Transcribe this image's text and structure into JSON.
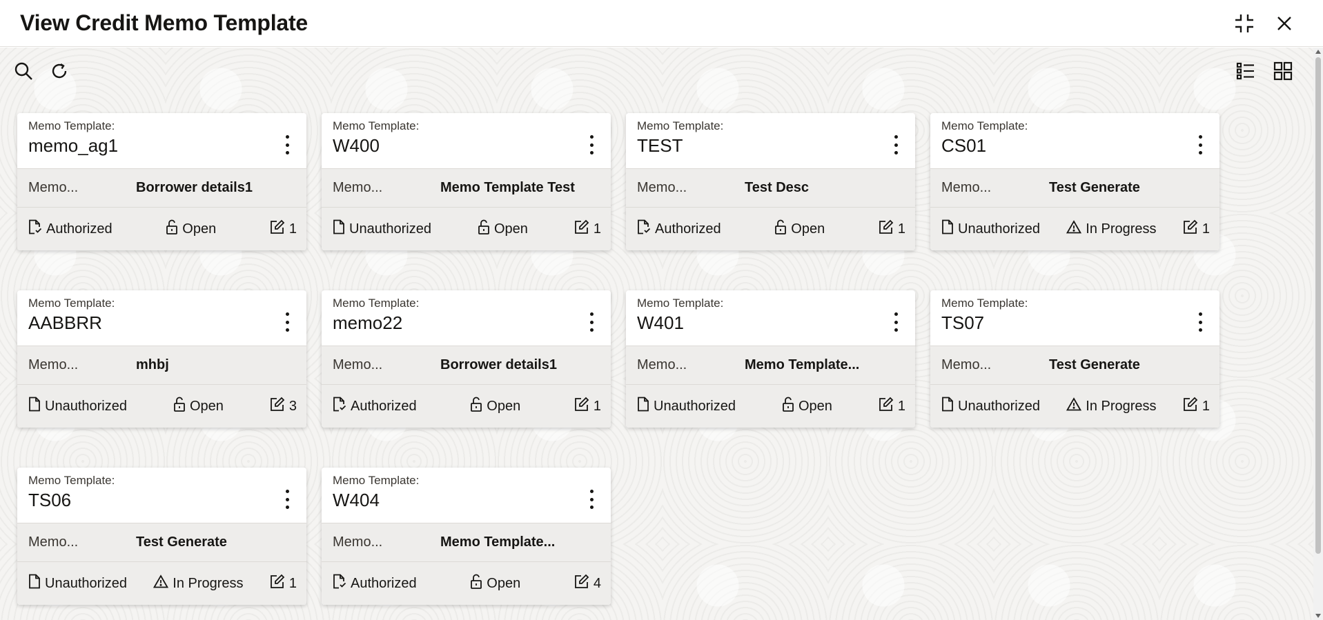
{
  "window": {
    "title": "View Credit Memo Template"
  },
  "cards": [
    {
      "label": "Memo Template:",
      "name": "memo_ag1",
      "desc_label": "Memo...",
      "desc_value": "Borrower details1",
      "status": "Authorized",
      "status_icon": "doc-check-icon",
      "lock": "Open",
      "lock_icon": "unlock-icon",
      "edits": "1"
    },
    {
      "label": "Memo Template:",
      "name": "W400",
      "desc_label": "Memo...",
      "desc_value": "Memo Template Test",
      "status": "Unauthorized",
      "status_icon": "doc-icon",
      "lock": "Open",
      "lock_icon": "unlock-icon",
      "edits": "1"
    },
    {
      "label": "Memo Template:",
      "name": "TEST",
      "desc_label": "Memo...",
      "desc_value": "Test Desc",
      "status": "Authorized",
      "status_icon": "doc-check-icon",
      "lock": "Open",
      "lock_icon": "unlock-icon",
      "edits": "1"
    },
    {
      "label": "Memo Template:",
      "name": "CS01",
      "desc_label": "Memo...",
      "desc_value": "Test Generate",
      "status": "Unauthorized",
      "status_icon": "doc-icon",
      "lock": "In Progress",
      "lock_icon": "warning-icon",
      "edits": "1"
    },
    {
      "label": "Memo Template:",
      "name": "AABBRR",
      "desc_label": "Memo...",
      "desc_value": "mhbj",
      "status": "Unauthorized",
      "status_icon": "doc-icon",
      "lock": "Open",
      "lock_icon": "unlock-icon",
      "edits": "3"
    },
    {
      "label": "Memo Template:",
      "name": "memo22",
      "desc_label": "Memo...",
      "desc_value": "Borrower details1",
      "status": "Authorized",
      "status_icon": "doc-check-icon",
      "lock": "Open",
      "lock_icon": "unlock-icon",
      "edits": "1"
    },
    {
      "label": "Memo Template:",
      "name": "W401",
      "desc_label": "Memo...",
      "desc_value": "Memo Template...",
      "status": "Unauthorized",
      "status_icon": "doc-icon",
      "lock": "Open",
      "lock_icon": "unlock-icon",
      "edits": "1"
    },
    {
      "label": "Memo Template:",
      "name": "TS07",
      "desc_label": "Memo...",
      "desc_value": "Test Generate",
      "status": "Unauthorized",
      "status_icon": "doc-icon",
      "lock": "In Progress",
      "lock_icon": "warning-icon",
      "edits": "1"
    },
    {
      "label": "Memo Template:",
      "name": "TS06",
      "desc_label": "Memo...",
      "desc_value": "Test Generate",
      "status": "Unauthorized",
      "status_icon": "doc-icon",
      "lock": "In Progress",
      "lock_icon": "warning-icon",
      "edits": "1"
    },
    {
      "label": "Memo Template:",
      "name": "W404",
      "desc_label": "Memo...",
      "desc_value": "Memo Template...",
      "status": "Authorized",
      "status_icon": "doc-check-icon",
      "lock": "Open",
      "lock_icon": "unlock-icon",
      "edits": "4"
    }
  ],
  "icons": {
    "toolbar_left": [
      "search-icon",
      "refresh-icon"
    ],
    "toolbar_right": [
      "list-view-icon",
      "grid-view-icon"
    ],
    "title_actions": [
      "minimize-icon",
      "close-icon"
    ]
  },
  "colors": {
    "text": "#161513",
    "card_band": "#eeedeb",
    "background": "#f5f4f2"
  }
}
